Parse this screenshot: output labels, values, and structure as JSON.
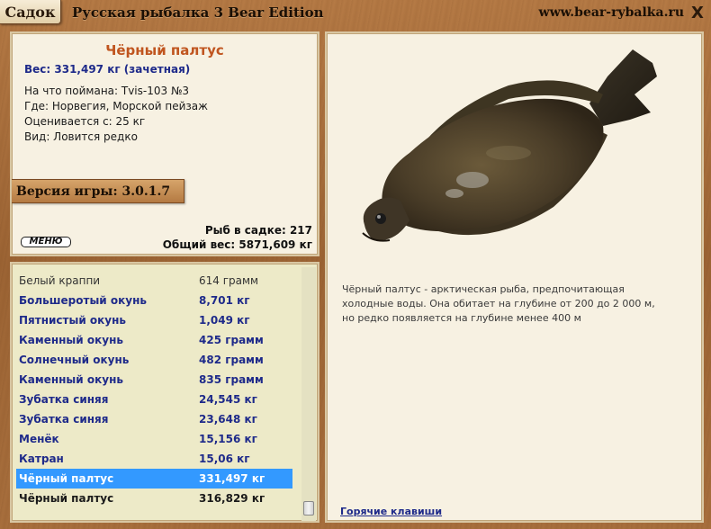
{
  "header": {
    "tab_label": "Садок",
    "title": "Русская рыбалка 3 Bear Edition",
    "site": "www.bear-rybalka.ru",
    "close_glyph": "X"
  },
  "info": {
    "fish_name": "Чёрный палтус",
    "weight": "Вес: 331,497 кг (зачетная)",
    "lines": [
      "На что поймана: Tvis-103 №3",
      "Где: Норвегия, Морской пейзаж",
      "Оценивается с: 25 кг",
      "Вид: Ловится редко"
    ],
    "version": "Версия игры: 3.0.1.7",
    "menu_label": "МЕНЮ",
    "fish_count": "Рыб в садке: 217",
    "total_weight": "Общий вес: 5871,609 кг"
  },
  "description": "Чёрный палтус - арктическая рыба, предпочитающая холодные воды. Она обитает на глубине от 200 до 2 000 м, но редко появляется на глубине менее 400 м",
  "hotkeys_link": "Горячие клавиши",
  "catch_list": [
    {
      "name": "Белый краппи",
      "weight": "614 грамм",
      "style": "normal"
    },
    {
      "name": "Большеротый окунь",
      "weight": "8,701 кг",
      "style": "blue"
    },
    {
      "name": "Пятнистый окунь",
      "weight": "1,049 кг",
      "style": "blue"
    },
    {
      "name": "Каменный окунь",
      "weight": "425 грамм",
      "style": "blue"
    },
    {
      "name": "Солнечный окунь",
      "weight": "482 грамм",
      "style": "blue"
    },
    {
      "name": "Каменный окунь",
      "weight": "835 грамм",
      "style": "blue"
    },
    {
      "name": "Зубатка синяя",
      "weight": "24,545 кг",
      "style": "blue"
    },
    {
      "name": "Зубатка синяя",
      "weight": "23,648 кг",
      "style": "blue"
    },
    {
      "name": "Менёк",
      "weight": "15,156 кг",
      "style": "blue"
    },
    {
      "name": "Катран",
      "weight": "15,06 кг",
      "style": "blue"
    },
    {
      "name": "Чёрный палтус",
      "weight": "331,497 кг",
      "style": "selected"
    },
    {
      "name": "Чёрный палтус",
      "weight": "316,829 кг",
      "style": "black"
    }
  ],
  "colors": {
    "accent_name": "#c0551f",
    "link_blue": "#1e2a8a",
    "selection": "#3399ff"
  }
}
